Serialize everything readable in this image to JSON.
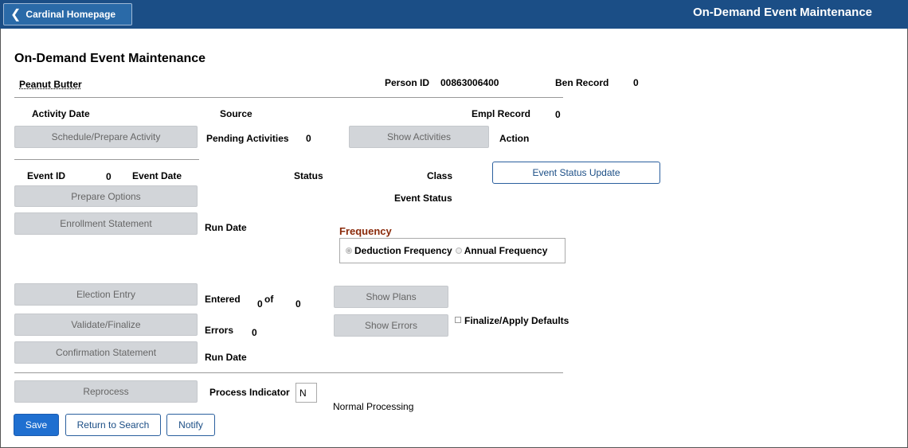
{
  "topbar": {
    "home_label": "Cardinal Homepage",
    "page_header": "On-Demand Event Maintenance"
  },
  "page_title": "On-Demand Event Maintenance",
  "employee": {
    "name": "Peanut Butter",
    "person_id_label": "Person ID",
    "person_id": "00863006400",
    "ben_record_label": "Ben Record",
    "ben_record": "0"
  },
  "activity": {
    "activity_date_label": "Activity Date",
    "source_label": "Source",
    "empl_record_label": "Empl Record",
    "empl_record": "0",
    "schedule_button": "Schedule/Prepare Activity",
    "pending_label": "Pending Activities",
    "pending_count": "0",
    "show_activities_button": "Show Activities",
    "action_label": "Action"
  },
  "event": {
    "event_id_label": "Event ID",
    "event_id": "0",
    "event_date_label": "Event Date",
    "status_label": "Status",
    "class_label": "Class",
    "event_status_update_button": "Event Status Update",
    "prepare_options_button": "Prepare Options",
    "event_status_label": "Event Status",
    "enrollment_statement_button": "Enrollment Statement",
    "run_date_label": "Run Date"
  },
  "frequency": {
    "label": "Frequency",
    "options": [
      "Deduction Frequency",
      "Annual Frequency"
    ],
    "selected": "Deduction Frequency"
  },
  "election": {
    "election_entry_button": "Election Entry",
    "entered_label": "Entered",
    "entered_count": "0",
    "of_label": "of",
    "total_count": "0",
    "show_plans_button": "Show Plans",
    "validate_button": "Validate/Finalize",
    "errors_label": "Errors",
    "errors_count": "0",
    "show_errors_button": "Show Errors",
    "finalize_defaults_label": "Finalize/Apply Defaults",
    "confirmation_button": "Confirmation Statement",
    "run_date_label": "Run Date"
  },
  "process": {
    "reprocess_button": "Reprocess",
    "indicator_label": "Process Indicator",
    "indicator_value": "N",
    "indicator_text": "Normal Processing"
  },
  "footer": {
    "save": "Save",
    "return_to_search": "Return to Search",
    "notify": "Notify"
  },
  "colors": {
    "topbar": "#1b4e86",
    "primary_button": "#1f6fd0",
    "frequency_label": "#8a2a0a"
  }
}
